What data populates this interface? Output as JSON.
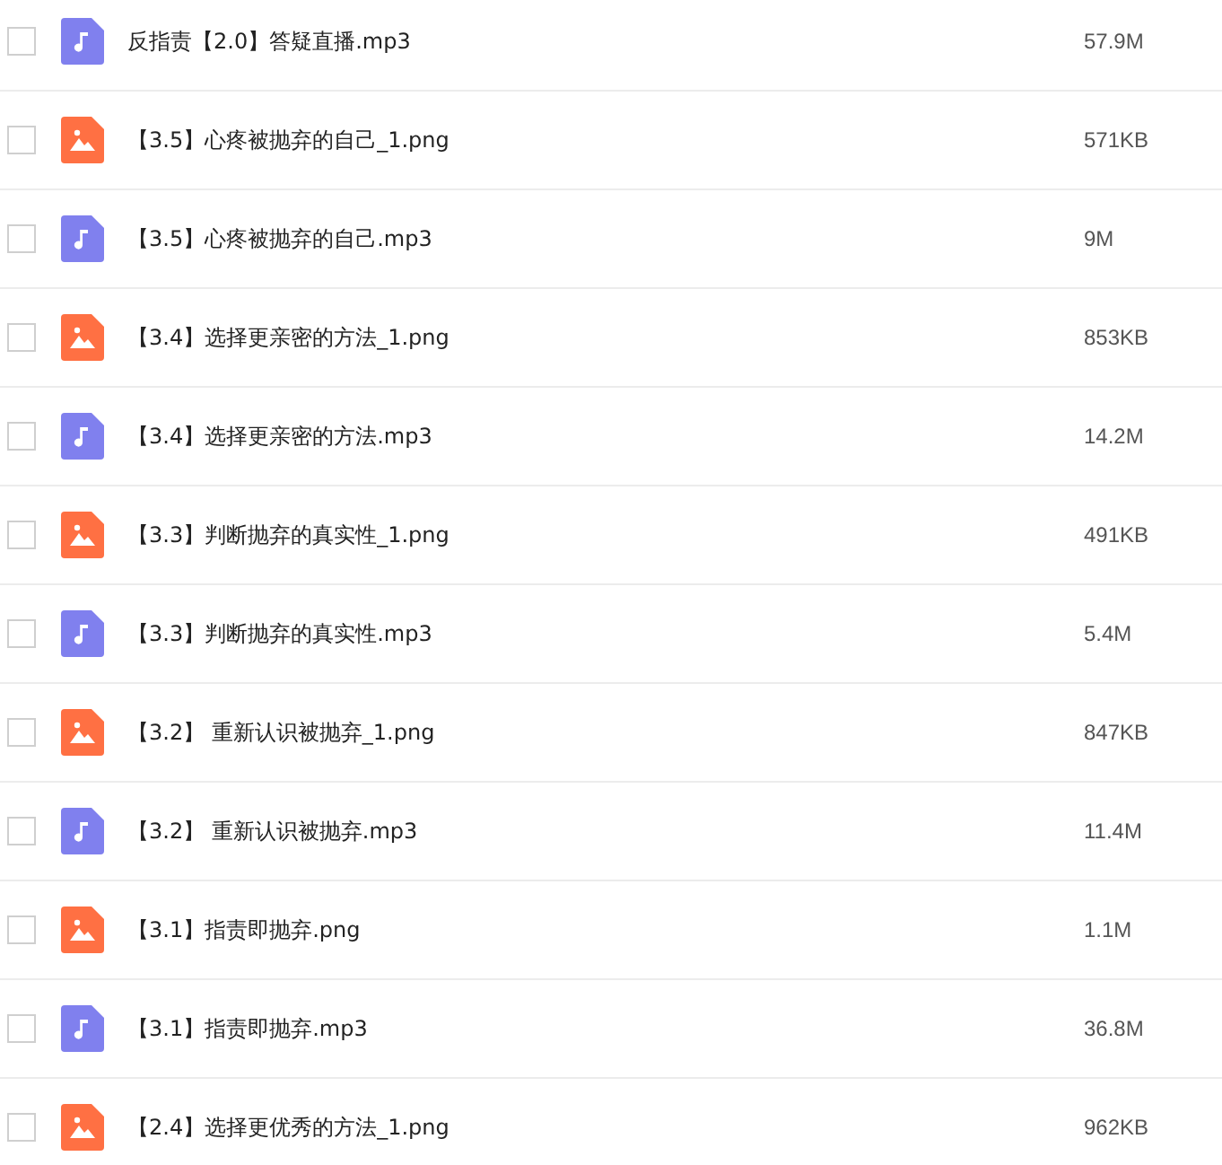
{
  "files": [
    {
      "kind": "audio",
      "name": "反指责【2.0】答疑直播.mp3",
      "size": "57.9M",
      "checked": false
    },
    {
      "kind": "image",
      "name": "【3.5】心疼被抛弃的自己_1.png",
      "size": "571KB",
      "checked": false
    },
    {
      "kind": "audio",
      "name": "【3.5】心疼被抛弃的自己.mp3",
      "size": "9M",
      "checked": false
    },
    {
      "kind": "image",
      "name": "【3.4】选择更亲密的方法_1.png",
      "size": "853KB",
      "checked": false
    },
    {
      "kind": "audio",
      "name": "【3.4】选择更亲密的方法.mp3",
      "size": "14.2M",
      "checked": false
    },
    {
      "kind": "image",
      "name": "【3.3】判断抛弃的真实性_1.png",
      "size": "491KB",
      "checked": false
    },
    {
      "kind": "audio",
      "name": "【3.3】判断抛弃的真实性.mp3",
      "size": "5.4M",
      "checked": false
    },
    {
      "kind": "image",
      "name": "【3.2】 重新认识被抛弃_1.png",
      "size": "847KB",
      "checked": false
    },
    {
      "kind": "audio",
      "name": "【3.2】 重新认识被抛弃.mp3",
      "size": "11.4M",
      "checked": false
    },
    {
      "kind": "image",
      "name": "【3.1】指责即抛弃.png",
      "size": "1.1M",
      "checked": false
    },
    {
      "kind": "audio",
      "name": "【3.1】指责即抛弃.mp3",
      "size": "36.8M",
      "checked": false
    },
    {
      "kind": "image",
      "name": "【2.4】选择更优秀的方法_1.png",
      "size": "962KB",
      "checked": false
    }
  ]
}
